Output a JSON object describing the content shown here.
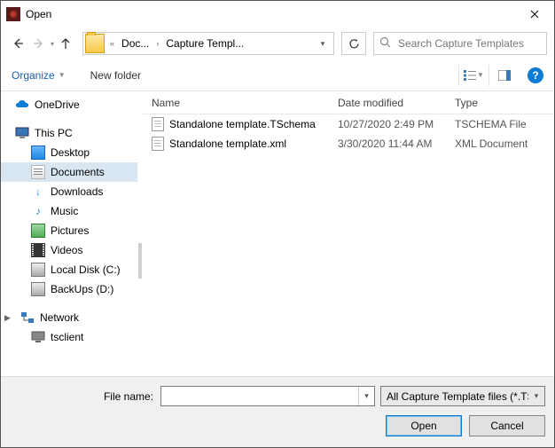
{
  "window": {
    "title": "Open"
  },
  "breadcrumb": {
    "seg1": "Doc...",
    "seg2": "Capture Templ..."
  },
  "search": {
    "placeholder": "Search Capture Templates"
  },
  "toolbar": {
    "organize": "Organize",
    "new_folder": "New folder",
    "help": "?"
  },
  "tree": {
    "onedrive": "OneDrive",
    "thispc": "This PC",
    "desktop": "Desktop",
    "documents": "Documents",
    "downloads": "Downloads",
    "music": "Music",
    "pictures": "Pictures",
    "videos": "Videos",
    "localdisk": "Local Disk (C:)",
    "backups": "BackUps (D:)",
    "network": "Network",
    "tsclient": "tsclient"
  },
  "columns": {
    "name": "Name",
    "date": "Date modified",
    "type": "Type"
  },
  "files": [
    {
      "name": "Standalone template.TSchema",
      "date": "10/27/2020 2:49 PM",
      "type": "TSCHEMA File"
    },
    {
      "name": "Standalone template.xml",
      "date": "3/30/2020 11:44 AM",
      "type": "XML Document"
    }
  ],
  "footer": {
    "filename_label": "File name:",
    "filename_value": "",
    "filter": "All Capture Template files (*.TSchema;*.xml)",
    "open": "Open",
    "cancel": "Cancel"
  }
}
